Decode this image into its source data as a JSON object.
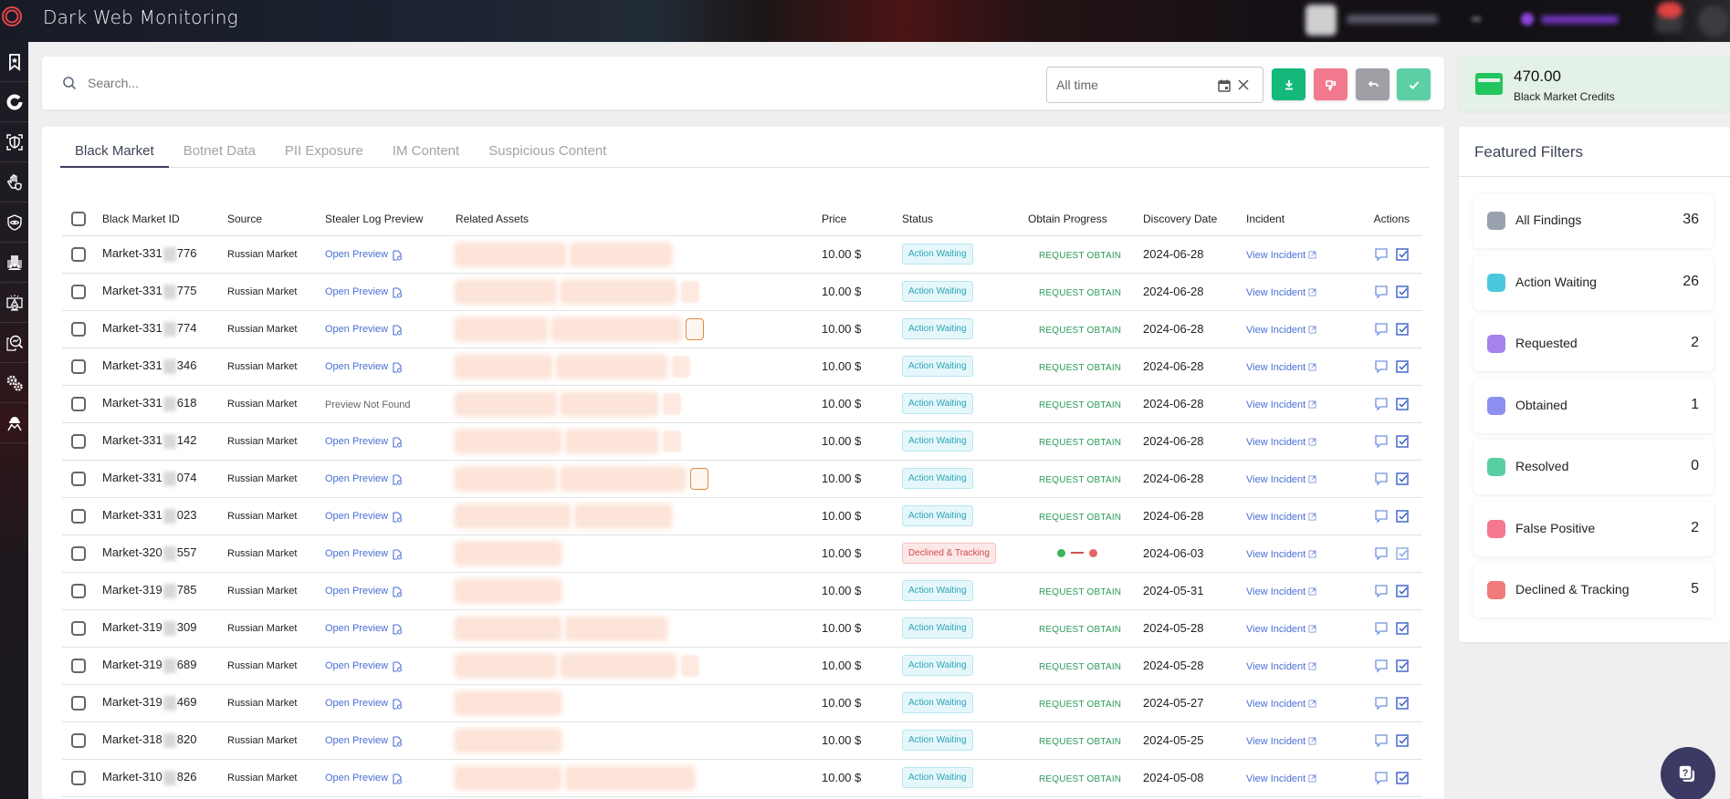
{
  "header": {
    "title": "Dark Web Monitoring"
  },
  "sidebar": {
    "items": [
      {
        "icon": "bookmark-star-icon"
      },
      {
        "icon": "donut-chart-icon"
      },
      {
        "icon": "shield-scan-icon"
      },
      {
        "icon": "hand-shield-icon"
      },
      {
        "icon": "shield-eye-icon"
      },
      {
        "icon": "building-people-icon"
      },
      {
        "icon": "monitor-alert-icon"
      },
      {
        "icon": "search-analytics-icon"
      },
      {
        "icon": "gears-icon"
      },
      {
        "icon": "hacker-icon"
      }
    ]
  },
  "toolbar": {
    "search_placeholder": "Search...",
    "date_placeholder": "All time",
    "buttons": [
      {
        "name": "download",
        "color": "#14b87a"
      },
      {
        "name": "false-positive",
        "color": "#f27a8e"
      },
      {
        "name": "undo",
        "color": "#9ea0a6"
      },
      {
        "name": "resolve",
        "color": "#5ccfa4"
      }
    ]
  },
  "credits": {
    "amount": "470.00",
    "label": "Black Market Credits"
  },
  "tabs": [
    {
      "label": "Black Market",
      "active": true
    },
    {
      "label": "Botnet Data",
      "active": false
    },
    {
      "label": "PII Exposure",
      "active": false
    },
    {
      "label": "IM Content",
      "active": false
    },
    {
      "label": "Suspicious Content",
      "active": false
    }
  ],
  "table": {
    "columns": [
      "Black Market ID",
      "Source",
      "Stealer Log Preview",
      "Related Assets",
      "Price",
      "Status",
      "Obtain Progress",
      "Discovery Date",
      "Incident",
      "Actions"
    ],
    "rows": [
      {
        "id_prefix": "Market-331",
        "id_suffix": "776",
        "source": "Russian Market",
        "preview": "Open Preview",
        "has_preview": true,
        "price": "10.00 $",
        "status": "Action Waiting",
        "obtain": "REQUEST OBTAIN",
        "date": "2024-06-28",
        "incident": "View Incident",
        "chips": [
          2
        ],
        "more": false
      },
      {
        "id_prefix": "Market-331",
        "id_suffix": "775",
        "source": "Russian Market",
        "preview": "Open Preview",
        "has_preview": true,
        "price": "10.00 $",
        "status": "Action Waiting",
        "obtain": "REQUEST OBTAIN",
        "date": "2024-06-28",
        "incident": "View Incident",
        "chips": [
          2
        ],
        "more": true
      },
      {
        "id_prefix": "Market-331",
        "id_suffix": "774",
        "source": "Russian Market",
        "preview": "Open Preview",
        "has_preview": true,
        "price": "10.00 $",
        "status": "Action Waiting",
        "obtain": "REQUEST OBTAIN",
        "date": "2024-06-28",
        "incident": "View Incident",
        "chips": [
          2
        ],
        "more": "bordered"
      },
      {
        "id_prefix": "Market-331",
        "id_suffix": "346",
        "source": "Russian Market",
        "preview": "Open Preview",
        "has_preview": true,
        "price": "10.00 $",
        "status": "Action Waiting",
        "obtain": "REQUEST OBTAIN",
        "date": "2024-06-28",
        "incident": "View Incident",
        "chips": [
          2
        ],
        "more": true
      },
      {
        "id_prefix": "Market-331",
        "id_suffix": "618",
        "source": "Russian Market",
        "preview": "Preview Not Found",
        "has_preview": false,
        "price": "10.00 $",
        "status": "Action Waiting",
        "obtain": "REQUEST OBTAIN",
        "date": "2024-06-28",
        "incident": "View Incident",
        "chips": [
          2
        ],
        "more": true
      },
      {
        "id_prefix": "Market-331",
        "id_suffix": "142",
        "source": "Russian Market",
        "preview": "Open Preview",
        "has_preview": true,
        "price": "10.00 $",
        "status": "Action Waiting",
        "obtain": "REQUEST OBTAIN",
        "date": "2024-06-28",
        "incident": "View Incident",
        "chips": [
          2
        ],
        "more": true
      },
      {
        "id_prefix": "Market-331",
        "id_suffix": "074",
        "source": "Russian Market",
        "preview": "Open Preview",
        "has_preview": true,
        "price": "10.00 $",
        "status": "Action Waiting",
        "obtain": "REQUEST OBTAIN",
        "date": "2024-06-28",
        "incident": "View Incident",
        "chips": [
          2
        ],
        "more": "bordered"
      },
      {
        "id_prefix": "Market-331",
        "id_suffix": "023",
        "source": "Russian Market",
        "preview": "Open Preview",
        "has_preview": true,
        "price": "10.00 $",
        "status": "Action Waiting",
        "obtain": "REQUEST OBTAIN",
        "date": "2024-06-28",
        "incident": "View Incident",
        "chips": [
          2
        ],
        "more": false
      },
      {
        "id_prefix": "Market-320",
        "id_suffix": "557",
        "source": "Russian Market",
        "preview": "Open Preview",
        "has_preview": true,
        "price": "10.00 $",
        "status": "Declined & Tracking",
        "obtain": "",
        "date": "2024-06-03",
        "incident": "View Incident",
        "chips": [
          1
        ],
        "more": false
      },
      {
        "id_prefix": "Market-319",
        "id_suffix": "785",
        "source": "Russian Market",
        "preview": "Open Preview",
        "has_preview": true,
        "price": "10.00 $",
        "status": "Action Waiting",
        "obtain": "REQUEST OBTAIN",
        "date": "2024-05-31",
        "incident": "View Incident",
        "chips": [
          1
        ],
        "more": false
      },
      {
        "id_prefix": "Market-319",
        "id_suffix": "309",
        "source": "Russian Market",
        "preview": "Open Preview",
        "has_preview": true,
        "price": "10.00 $",
        "status": "Action Waiting",
        "obtain": "REQUEST OBTAIN",
        "date": "2024-05-28",
        "incident": "View Incident",
        "chips": [
          2
        ],
        "more": false
      },
      {
        "id_prefix": "Market-319",
        "id_suffix": "689",
        "source": "Russian Market",
        "preview": "Open Preview",
        "has_preview": true,
        "price": "10.00 $",
        "status": "Action Waiting",
        "obtain": "REQUEST OBTAIN",
        "date": "2024-05-28",
        "incident": "View Incident",
        "chips": [
          2
        ],
        "more": true
      },
      {
        "id_prefix": "Market-319",
        "id_suffix": "469",
        "source": "Russian Market",
        "preview": "Open Preview",
        "has_preview": true,
        "price": "10.00 $",
        "status": "Action Waiting",
        "obtain": "REQUEST OBTAIN",
        "date": "2024-05-27",
        "incident": "View Incident",
        "chips": [
          1
        ],
        "more": false
      },
      {
        "id_prefix": "Market-318",
        "id_suffix": "820",
        "source": "Russian Market",
        "preview": "Open Preview",
        "has_preview": true,
        "price": "10.00 $",
        "status": "Action Waiting",
        "obtain": "REQUEST OBTAIN",
        "date": "2024-05-25",
        "incident": "View Incident",
        "chips": [
          1
        ],
        "more": false
      },
      {
        "id_prefix": "Market-310",
        "id_suffix": "826",
        "source": "Russian Market",
        "preview": "Open Preview",
        "has_preview": true,
        "price": "10.00 $",
        "status": "Action Waiting",
        "obtain": "REQUEST OBTAIN",
        "date": "2024-05-08",
        "incident": "View Incident",
        "chips": [
          2
        ],
        "more": false
      }
    ]
  },
  "featured_filters": {
    "title": "Featured Filters",
    "items": [
      {
        "label": "All Findings",
        "count": "36",
        "color": "#99a1ae"
      },
      {
        "label": "Action Waiting",
        "count": "26",
        "color": "#4cc8dc"
      },
      {
        "label": "Requested",
        "count": "2",
        "color": "#a583ec"
      },
      {
        "label": "Obtained",
        "count": "1",
        "color": "#8d8ff0"
      },
      {
        "label": "Resolved",
        "count": "0",
        "color": "#57cfa2"
      },
      {
        "label": "False Positive",
        "count": "2",
        "color": "#f47890"
      },
      {
        "label": "Declined & Tracking",
        "count": "5",
        "color": "#f07b7b"
      }
    ]
  },
  "colors": {
    "link": "#4a6fd4",
    "obtain_green": "#2a9a5a",
    "progress_green": "#3bb55a",
    "progress_red": "#e36464"
  }
}
